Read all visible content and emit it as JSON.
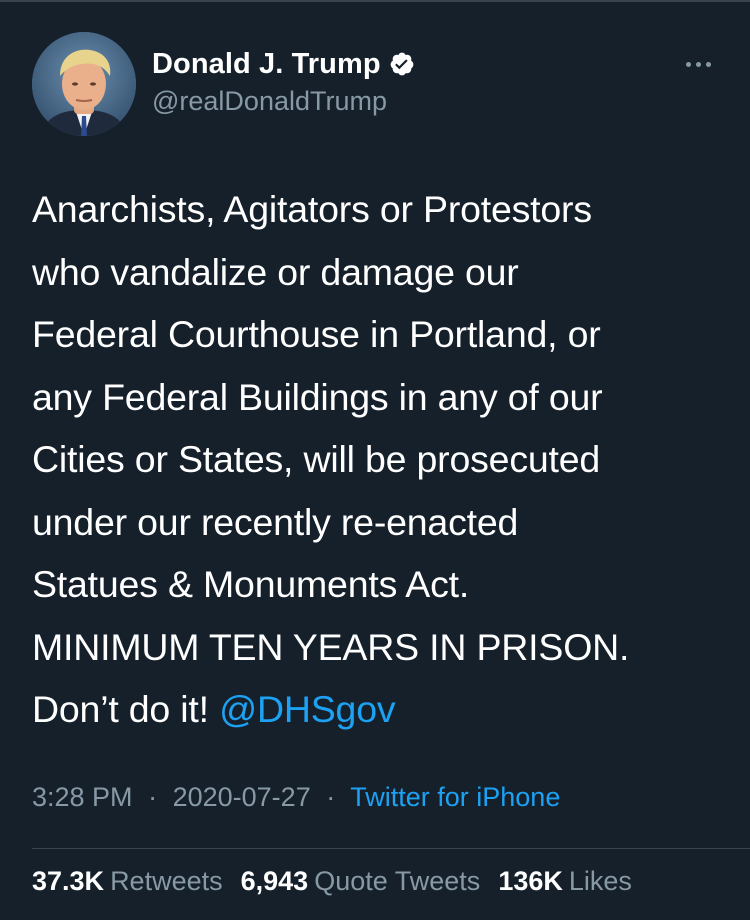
{
  "tweet": {
    "author": {
      "display_name": "Donald J. Trump",
      "handle": "@realDonaldTrump",
      "verified_icon": "verified-badge-icon",
      "avatar_icon": "avatar-portrait"
    },
    "more_icon": "more-options-icon",
    "text": "Anarchists, Agitators or Protestors\nwho vandalize or damage our\nFederal Courthouse in Portland, or\nany Federal Buildings in any of our\nCities or States, will be prosecuted\nunder our recently re-enacted\nStatues & Monuments Act.\nMINIMUM TEN YEARS IN PRISON.\nDon’t do it! ",
    "mention": "@DHSgov",
    "time": "3:28 PM",
    "date": "2020-07-27",
    "separator": "·",
    "source": "Twitter for iPhone",
    "stats": {
      "retweets": {
        "count": "37.3K",
        "label": "Retweets"
      },
      "quote_tweets": {
        "count": "6,943",
        "label": "Quote Tweets"
      },
      "likes": {
        "count": "136K",
        "label": "Likes"
      }
    }
  },
  "colors": {
    "background": "#15202b",
    "text": "#ffffff",
    "secondary_text": "#8899a6",
    "accent": "#1da1f2",
    "divider": "#38444d"
  }
}
